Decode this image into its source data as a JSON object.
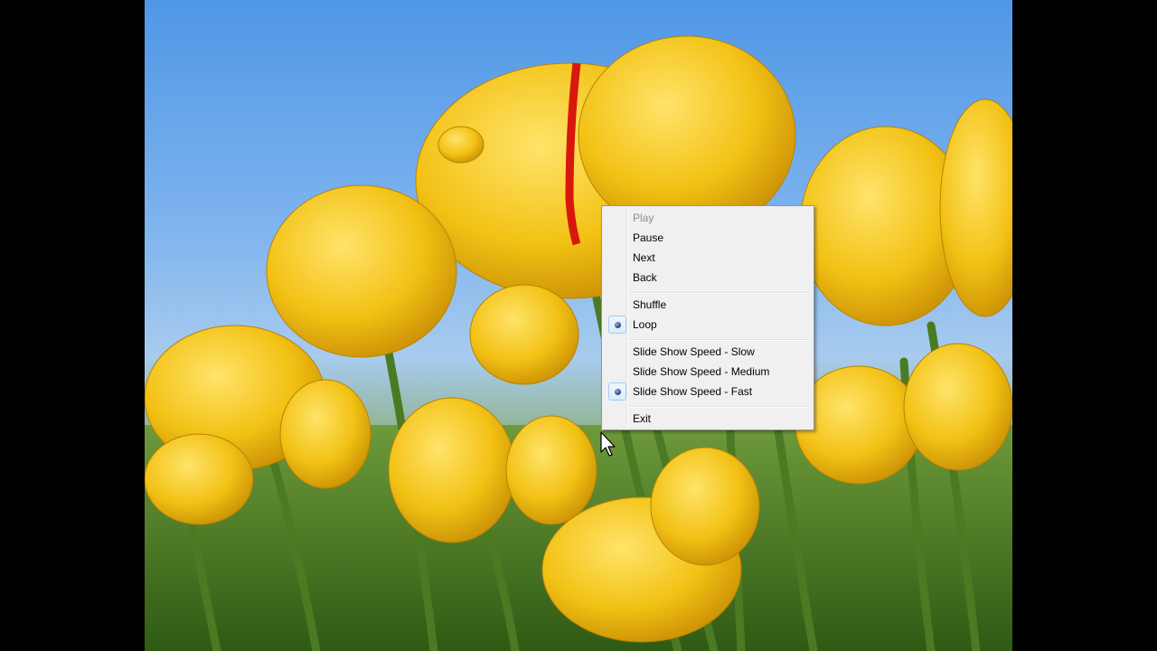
{
  "menu": {
    "items": [
      {
        "label": "Play",
        "disabled": true
      },
      {
        "label": "Pause"
      },
      {
        "label": "Next"
      },
      {
        "label": "Back"
      },
      {
        "label": "Shuffle"
      },
      {
        "label": "Loop",
        "checked": true
      },
      {
        "label": "Slide Show Speed - Slow"
      },
      {
        "label": "Slide Show Speed - Medium"
      },
      {
        "label": "Slide Show Speed - Fast",
        "checked": true
      },
      {
        "label": "Exit"
      }
    ]
  },
  "colors": {
    "sky": "#6fa9ec",
    "tulip": "#f5c81a",
    "stem": "#4a7a22",
    "menu_background": "#f0f0f0"
  },
  "icons": [
    "radio-bullet-icon",
    "mouse-pointer-icon"
  ]
}
